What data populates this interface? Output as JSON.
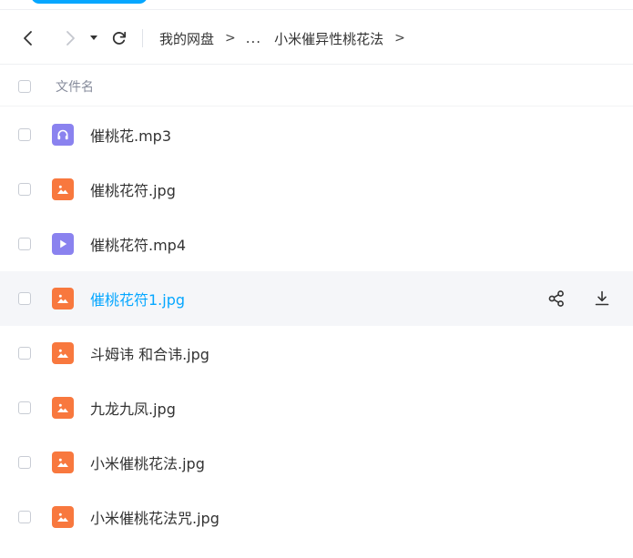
{
  "colors": {
    "accent": "#06a7ff",
    "image_icon": "#f8783e",
    "media_icon": "#8a82ef",
    "hover_row": "#f5f6f9"
  },
  "nav": {
    "back_icon": "chevron-left-icon",
    "forward_icon": "chevron-right-icon",
    "history_icon": "caret-down-icon",
    "refresh_icon": "refresh-icon"
  },
  "breadcrumb": {
    "root": "我的网盘",
    "ellipsis": "...",
    "current": "小米催异性桃花法",
    "separator": ">"
  },
  "list_header": {
    "name_label": "文件名"
  },
  "files": [
    {
      "name": "催桃花.mp3",
      "type": "audio",
      "icon": "headphones-icon"
    },
    {
      "name": "催桃花符.jpg",
      "type": "image",
      "icon": "image-icon"
    },
    {
      "name": "催桃花符.mp4",
      "type": "video",
      "icon": "play-icon"
    },
    {
      "name": "催桃花符1.jpg",
      "type": "image",
      "icon": "image-icon",
      "hovered": true
    },
    {
      "name": "斗姆讳 和合讳.jpg",
      "type": "image",
      "icon": "image-icon"
    },
    {
      "name": "九龙九凤.jpg",
      "type": "image",
      "icon": "image-icon"
    },
    {
      "name": "小米催桃花法.jpg",
      "type": "image",
      "icon": "image-icon"
    },
    {
      "name": "小米催桃花法咒.jpg",
      "type": "image",
      "icon": "image-icon"
    }
  ],
  "row_actions": [
    {
      "icon": "share-icon"
    },
    {
      "icon": "download-icon"
    }
  ]
}
